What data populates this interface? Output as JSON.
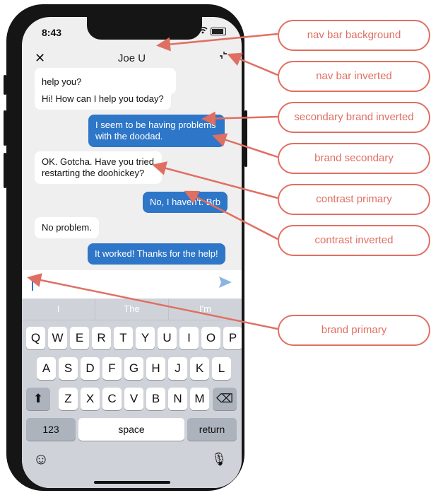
{
  "status": {
    "time": "8:43",
    "signal": "....."
  },
  "nav": {
    "close_icon": "✕",
    "title": "Joe U",
    "minimize_icon": "⌐"
  },
  "messages": [
    {
      "side": "in",
      "text": "help you?"
    },
    {
      "side": "in",
      "text": "Hi! How can I help you today?"
    },
    {
      "side": "out",
      "text": "I seem to be having problems\nwith the doodad."
    },
    {
      "side": "in",
      "text": "OK. Gotcha. Have you tried\nrestarting the doohickey?"
    },
    {
      "side": "out",
      "text": "No, I haven't. Brb"
    },
    {
      "side": "in",
      "text": "No problem."
    },
    {
      "side": "out",
      "text": "It worked! Thanks for the help!"
    }
  ],
  "suggestions": [
    "I",
    "The",
    "I'm"
  ],
  "keys": {
    "row1": [
      "Q",
      "W",
      "E",
      "R",
      "T",
      "Y",
      "U",
      "I",
      "O",
      "P"
    ],
    "row2": [
      "A",
      "S",
      "D",
      "F",
      "G",
      "H",
      "J",
      "K",
      "L"
    ],
    "row3": [
      "Z",
      "X",
      "C",
      "V",
      "B",
      "N",
      "M"
    ],
    "shift": "⬆",
    "backspace": "⌫",
    "numbers": "123",
    "space": "space",
    "return": "return",
    "emoji": "☺",
    "mic": "🎙"
  },
  "callouts": [
    {
      "label": "nav bar background"
    },
    {
      "label": "nav bar inverted"
    },
    {
      "label": "secondary brand inverted"
    },
    {
      "label": "brand secondary"
    },
    {
      "label": "contrast primary"
    },
    {
      "label": "contrast inverted"
    },
    {
      "label": "brand primary"
    }
  ],
  "colors": {
    "brand": "#2e76c7",
    "annotation": "#e06f63"
  }
}
